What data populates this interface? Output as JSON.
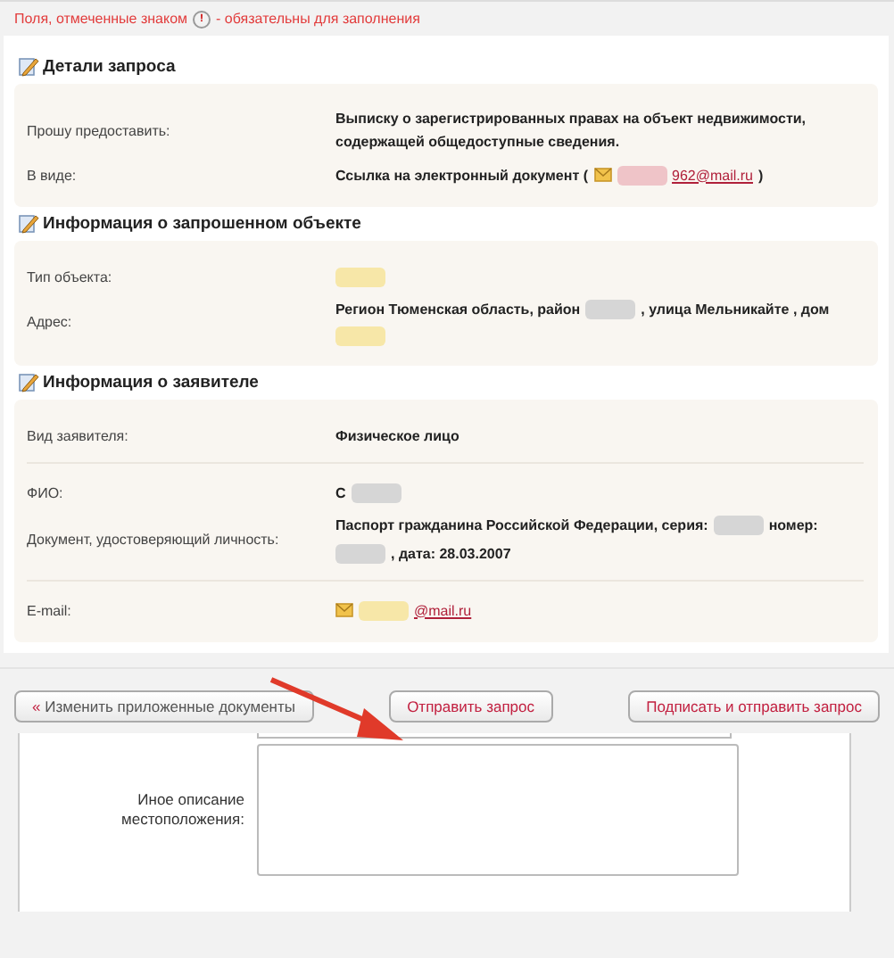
{
  "notice": {
    "before": "Поля, отмеченные знаком",
    "mark": "!",
    "after": "- обязательны для заполнения"
  },
  "sections": [
    {
      "title": "Детали запроса",
      "rows": [
        {
          "label": "Прошу предоставить:",
          "separated": false,
          "parts": [
            {
              "kind": "text",
              "text": "Выписку о зарегистрированных правах на объект недвижимости, содержащей общедоступные сведения."
            }
          ]
        },
        {
          "label": "В виде:",
          "separated": false,
          "parts": [
            {
              "kind": "text",
              "text": "Ссылка на электронный документ ("
            },
            {
              "kind": "mail"
            },
            {
              "kind": "blur",
              "color": "#efc4c8"
            },
            {
              "kind": "link",
              "text": "962@mail.ru"
            },
            {
              "kind": "text",
              "text": ")"
            }
          ]
        }
      ]
    },
    {
      "title": "Информация о запрошенном объекте",
      "rows": [
        {
          "label": "Тип объекта:",
          "separated": false,
          "parts": [
            {
              "kind": "blur",
              "color": "#f7e7a8"
            }
          ]
        },
        {
          "label": "Адрес:",
          "separated": false,
          "parts": [
            {
              "kind": "text",
              "text": "Регион Тюменская область, район"
            },
            {
              "kind": "blur",
              "color": "#d6d6d6"
            },
            {
              "kind": "text",
              "text": ", улица Мельникайте , дом"
            },
            {
              "kind": "blur",
              "color": "#f7e7a8"
            }
          ]
        }
      ]
    },
    {
      "title": "Информация о заявителе",
      "rows": [
        {
          "label": "Вид заявителя:",
          "separated": true,
          "parts": [
            {
              "kind": "text",
              "text": "Физическое лицо"
            }
          ]
        },
        {
          "label": "ФИО:",
          "separated": false,
          "parts": [
            {
              "kind": "text",
              "text": "С"
            },
            {
              "kind": "blur",
              "color": "#d6d6d6"
            }
          ]
        },
        {
          "label": "Документ, удостоверяющий личность:",
          "separated": true,
          "parts": [
            {
              "kind": "text",
              "text": "Паспорт гражданина Российской Федерации, серия:"
            },
            {
              "kind": "blur",
              "color": "#d6d6d6"
            },
            {
              "kind": "text",
              "text": "номер:"
            },
            {
              "kind": "blur",
              "color": "#d6d6d6"
            },
            {
              "kind": "text",
              "text": ", дата: 28.03.2007"
            }
          ]
        },
        {
          "label": "E-mail:",
          "separated": false,
          "parts": [
            {
              "kind": "mail"
            },
            {
              "kind": "blur",
              "color": "#f7e7a8"
            },
            {
              "kind": "link",
              "text": "@mail.ru"
            }
          ]
        }
      ]
    }
  ],
  "buttons": [
    {
      "prefix": "«",
      "label": "Изменить приложенные документы"
    },
    {
      "label": "Отправить запрос",
      "accent": true
    },
    {
      "label": "Подписать и отправить запрос",
      "accent": true
    }
  ],
  "form": {
    "label": "Иное описание местоположения:"
  }
}
